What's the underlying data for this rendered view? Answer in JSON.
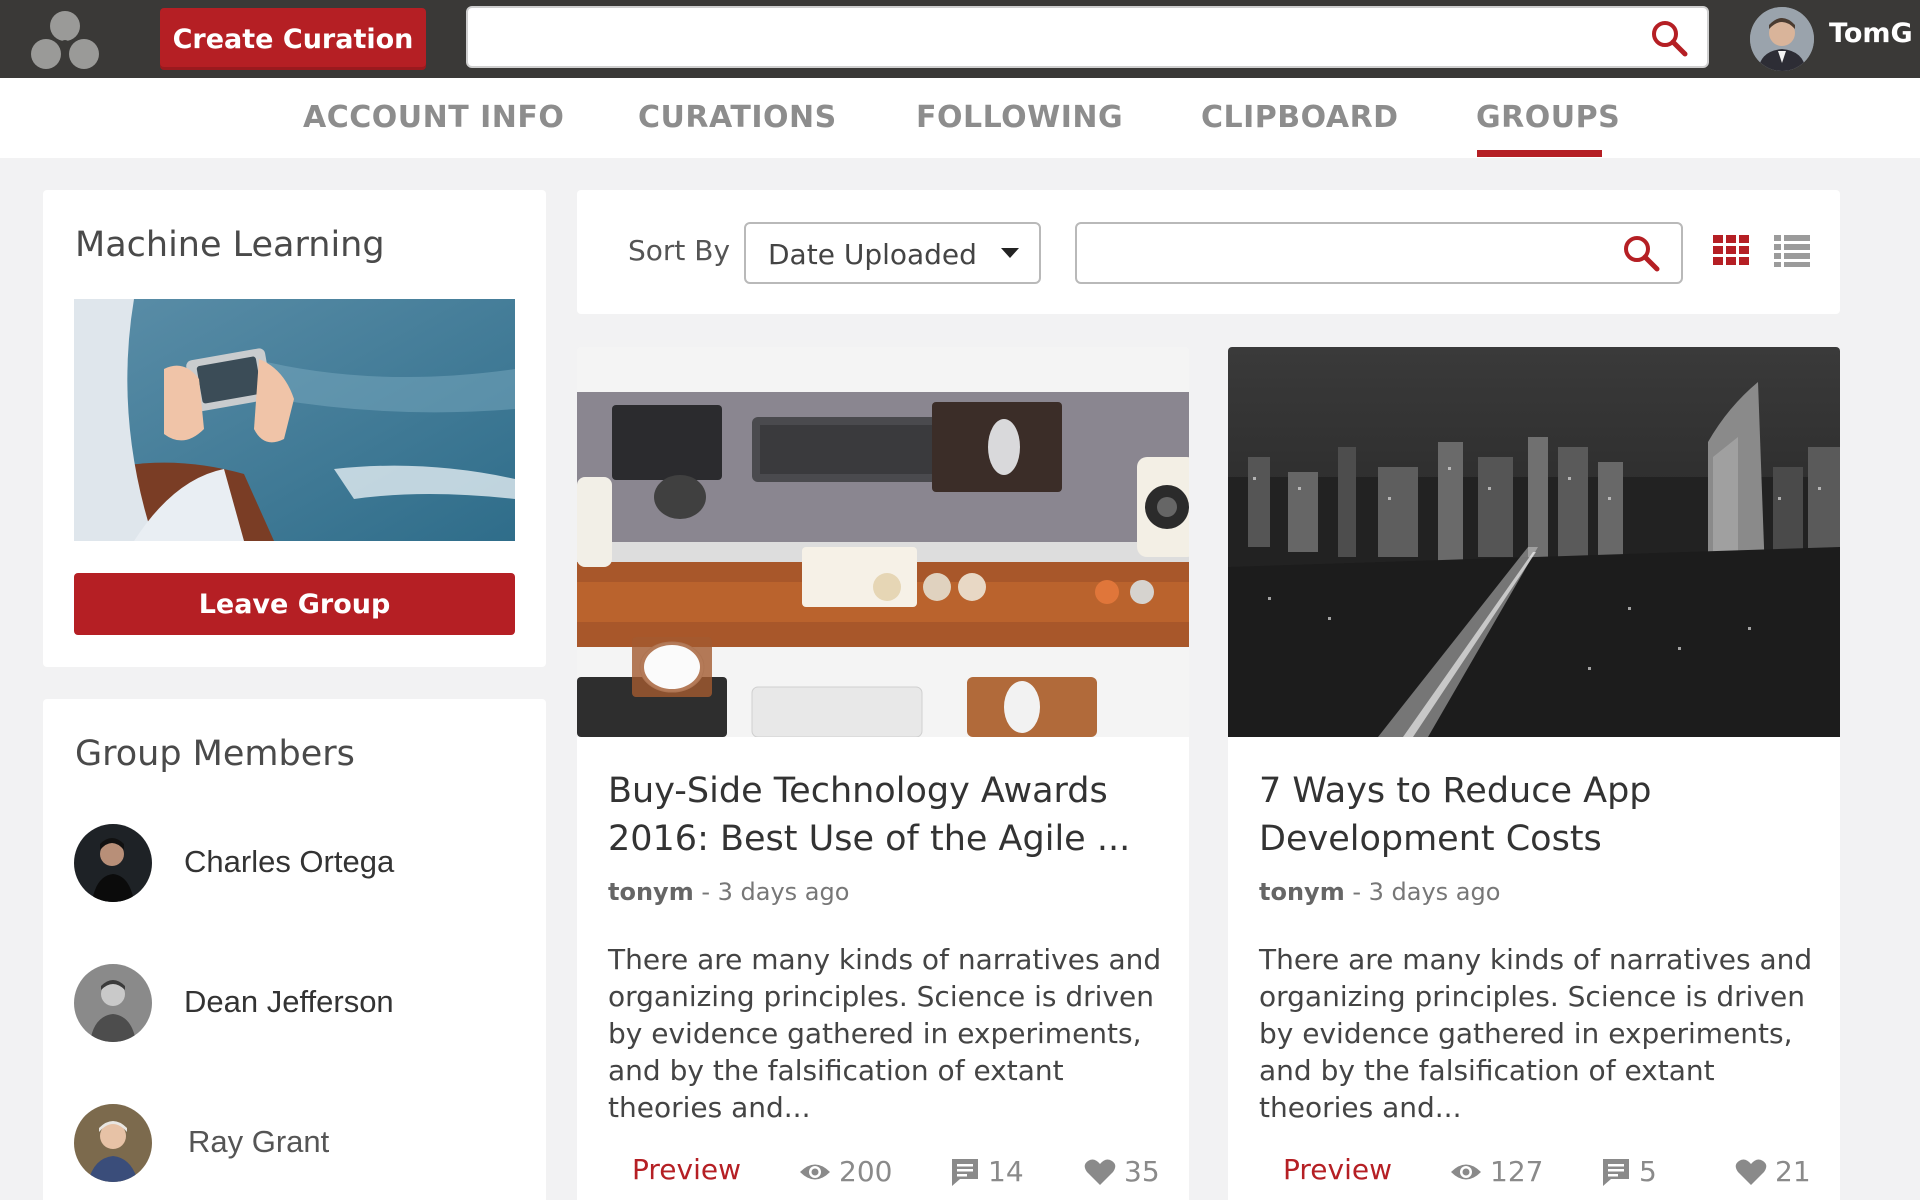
{
  "header": {
    "create_label": "Create Curation",
    "search_placeholder": "",
    "username": "TomG"
  },
  "nav": {
    "tabs": [
      {
        "label": "ACCOUNT INFO"
      },
      {
        "label": "CURATIONS"
      },
      {
        "label": "FOLLOWING"
      },
      {
        "label": "CLIPBOARD"
      },
      {
        "label": "GROUPS"
      }
    ],
    "active": "GROUPS"
  },
  "group": {
    "title": "Machine Learning",
    "leave_label": "Leave Group"
  },
  "members": {
    "title": "Group Members",
    "items": [
      {
        "name": "Charles Ortega"
      },
      {
        "name": "Dean Jefferson"
      },
      {
        "name": "Ray Grant"
      }
    ]
  },
  "toolbar": {
    "sort_label": "Sort By",
    "sort_value": "Date Uploaded",
    "search_placeholder": ""
  },
  "curations": [
    {
      "title": "Buy-Side Technology Awards 2016: Best Use of the Agile ...",
      "author": "tonym",
      "time": " - 3 days ago",
      "description": "There are many kinds of narratives and organizing principles. Science is driven by evidence gathered in experiments, and by the falsification of extant theories and...",
      "preview_label": "Preview",
      "views": "200",
      "comments": "14",
      "likes": "35"
    },
    {
      "title": "7 Ways to Reduce App Development Costs",
      "author": "tonym",
      "time": " - 3 days ago",
      "description": "There are many kinds of narratives and organizing principles. Science is driven by evidence gathered in experiments, and by the falsification of extant theories and...",
      "preview_label": "Preview",
      "views": "127",
      "comments": "5",
      "likes": "21"
    }
  ],
  "colors": {
    "accent": "#b51f24",
    "topbar": "#3a3937",
    "background": "#f2f2f3"
  },
  "icons": {
    "logo": "three-petal-logo-icon",
    "search": "search-icon",
    "grid_view": "grid-view-icon",
    "list_view": "list-view-icon",
    "views": "eye-icon",
    "comments": "comment-icon",
    "likes": "heart-icon"
  }
}
